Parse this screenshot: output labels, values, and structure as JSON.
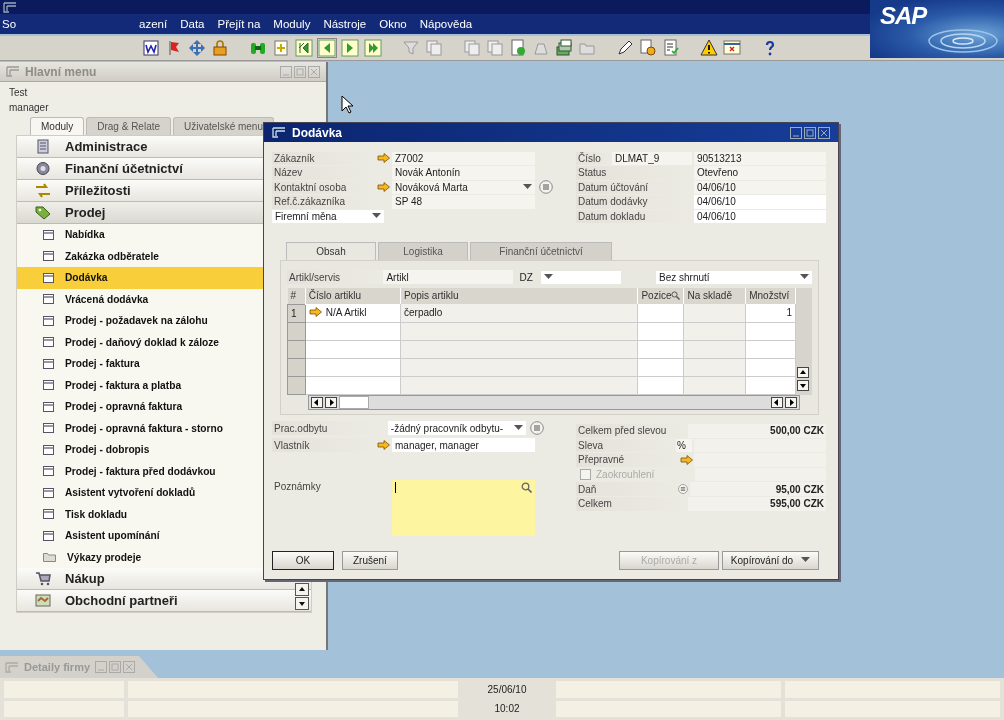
{
  "menu_bar": [
    {
      "label": "So"
    },
    {
      "label": "azení"
    },
    {
      "label": "Data"
    },
    {
      "label": "Přejít na"
    },
    {
      "label": "Moduly"
    },
    {
      "label": "Nástroje"
    },
    {
      "label": "Okno"
    },
    {
      "label": "Nápověda"
    }
  ],
  "logo": "SAP",
  "main_menu": {
    "title": "Hlavní menu",
    "company": "Test",
    "user": "manager",
    "tabs": [
      {
        "label": "Moduly",
        "selected": true
      },
      {
        "label": "Drag & Relate",
        "selected": false
      },
      {
        "label": "Uživatelské menu",
        "selected": false
      }
    ],
    "modules": [
      {
        "label": "Administrace",
        "expanded": false
      },
      {
        "label": "Finanční účetnictví",
        "expanded": false
      },
      {
        "label": "Příležitosti",
        "expanded": false
      },
      {
        "label": "Prodej",
        "expanded": true,
        "children": [
          {
            "label": "Nabídka",
            "kind": "form",
            "selected": false
          },
          {
            "label": "Zakázka odběratele",
            "kind": "form",
            "selected": false
          },
          {
            "label": "Dodávka",
            "kind": "form",
            "selected": true
          },
          {
            "label": "Vrácená dodávka",
            "kind": "form",
            "selected": false
          },
          {
            "label": "Prodej - požadavek na zálohu",
            "kind": "form",
            "selected": false
          },
          {
            "label": "Prodej - daňový doklad k záloze",
            "kind": "form",
            "selected": false
          },
          {
            "label": "Prodej - faktura",
            "kind": "form",
            "selected": false
          },
          {
            "label": "Prodej - faktura a platba",
            "kind": "form",
            "selected": false
          },
          {
            "label": "Prodej - opravná faktura",
            "kind": "form",
            "selected": false
          },
          {
            "label": "Prodej - opravná faktura - storno",
            "kind": "form",
            "selected": false
          },
          {
            "label": "Prodej - dobropis",
            "kind": "form",
            "selected": false
          },
          {
            "label": "Prodej - faktura před dodávkou",
            "kind": "form",
            "selected": false
          },
          {
            "label": "Asistent vytvoření dokladů",
            "kind": "form",
            "selected": false
          },
          {
            "label": "Tisk dokladu",
            "kind": "form",
            "selected": false
          },
          {
            "label": "Asistent upomínání",
            "kind": "form",
            "selected": false
          },
          {
            "label": "Výkazy prodeje",
            "kind": "folder",
            "selected": false
          }
        ]
      },
      {
        "label": "Nákup",
        "expanded": false
      },
      {
        "label": "Obchodní partneři",
        "expanded": false
      }
    ]
  },
  "document": {
    "title": "Dodávka",
    "header_left": [
      {
        "label": "Zákazník",
        "value": "Z7002",
        "link": true,
        "kind": "text"
      },
      {
        "label": "Název",
        "value": "Novák Antonín",
        "link": false,
        "kind": "text"
      },
      {
        "label": "Kontaktní osoba",
        "value": "Nováková Marta",
        "link": true,
        "kind": "dropdown"
      },
      {
        "label": "Ref.č.zákazníka",
        "value": "SP 48",
        "link": false,
        "kind": "text"
      },
      {
        "value": "Firemní měna",
        "kind": "select"
      }
    ],
    "header_right": [
      {
        "label": "Číslo",
        "series": "DLMAT_9",
        "value": "90513213"
      },
      {
        "label": "Status",
        "value": "Otevřeno"
      },
      {
        "label": "Datum účtování",
        "value": "04/06/10"
      },
      {
        "label": "Datum dodávky",
        "value": "04/06/10"
      },
      {
        "label": "Datum dokladu",
        "value": "04/06/10"
      }
    ],
    "tabs": [
      {
        "label": "Obsah",
        "selected": true
      },
      {
        "label": "Logistika",
        "selected": false
      },
      {
        "label": "Finanční účetnictví",
        "selected": false
      }
    ],
    "item_type": {
      "label": "Artikl/servis",
      "value": "Artikl"
    },
    "tax_code": {
      "label": "DZ"
    },
    "summary": {
      "value": "Bez shrnutí"
    },
    "table": {
      "columns": [
        "#",
        "Číslo artiklu",
        "Popis artiklu",
        "Pozice",
        "Na skladě",
        "Množství"
      ],
      "rows": [
        {
          "cells": [
            "1",
            "N/A Artikl",
            "čerpadlo",
            "",
            "",
            "1"
          ],
          "link": true
        }
      ]
    },
    "footer_left": [
      {
        "label": "Prac.odbytu",
        "value": "-žádný pracovník odbytu-",
        "kind": "dropdown"
      },
      {
        "label": "Vlastník",
        "value": "manager, manager",
        "kind": "link"
      },
      {
        "label": "Poznámky",
        "kind": "note"
      }
    ],
    "totals": [
      {
        "label": "Celkem před slevou",
        "value": "500,00 CZK",
        "kind": "amount"
      },
      {
        "label": "Sleva",
        "unit": "%",
        "kind": "percent"
      },
      {
        "label": "Přepravné",
        "kind": "link"
      },
      {
        "label": "Zaokrouhlení",
        "kind": "checkbox",
        "checked": false,
        "disabled": true
      },
      {
        "label": "Daň",
        "value": "95,00 CZK",
        "kind": "list"
      },
      {
        "label": "Celkem",
        "value": "595,00 CZK",
        "kind": "amount"
      }
    ],
    "buttons_left": [
      {
        "label": "OK",
        "default": true
      },
      {
        "label": "Zrušení",
        "default": false
      }
    ],
    "buttons_right": [
      {
        "label": "Kopírování z",
        "disabled": true,
        "dropdown": false
      },
      {
        "label": "Kopírování do",
        "disabled": false,
        "dropdown": true
      }
    ]
  },
  "taskbar": [
    {
      "label": "Detaily firmy"
    }
  ],
  "status_bar": {
    "date": "25/06/10",
    "time": "10:02"
  }
}
